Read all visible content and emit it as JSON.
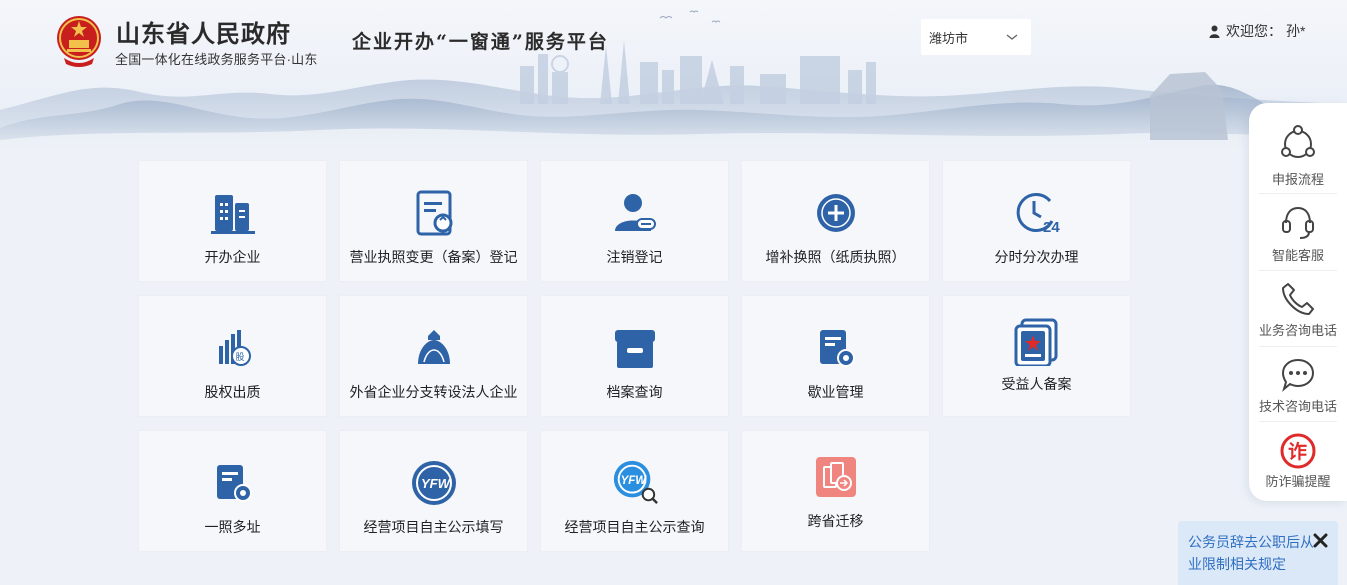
{
  "header": {
    "site_title": "山东省人民政府",
    "site_subtitle": "全国一体化在线政务服务平台·山东",
    "platform_title": "企业开办“一窗通”服务平台",
    "city_select": {
      "value": "潍坊市"
    },
    "user": {
      "greeting": "欢迎您：",
      "name": "孙*"
    }
  },
  "tiles": [
    {
      "label": "开办企业",
      "icon": "company-buildings-icon"
    },
    {
      "label": "营业执照变更（备案）登记",
      "icon": "document-change-icon"
    },
    {
      "label": "注销登记",
      "icon": "user-minus-icon"
    },
    {
      "label": "增补换照（纸质执照）",
      "icon": "plus-circle-icon"
    },
    {
      "label": "分时分次办理",
      "icon": "clock-24-icon"
    },
    {
      "label": "股权出质",
      "icon": "equity-pledge-icon"
    },
    {
      "label": "外省企业分支转设法人企业",
      "icon": "money-bag-icon"
    },
    {
      "label": "档案查询",
      "icon": "archive-box-icon"
    },
    {
      "label": "歇业管理",
      "icon": "document-gear-icon"
    },
    {
      "label": "受益人备案",
      "icon": "beneficiary-star-icon"
    },
    {
      "label": "一照多址",
      "icon": "license-gear-icon"
    },
    {
      "label": "经营项目自主公示填写",
      "icon": "yfw-badge-icon"
    },
    {
      "label": "经营项目自主公示查询",
      "icon": "yfw-search-icon"
    },
    {
      "label": "跨省迁移",
      "icon": "relocation-icon"
    }
  ],
  "float_bar": [
    {
      "label": "申报流程",
      "icon": "process-flow-icon"
    },
    {
      "label": "智能客服",
      "icon": "headset-icon"
    },
    {
      "label": "业务咨询电话",
      "icon": "phone-icon"
    },
    {
      "label": "技术咨询电话",
      "icon": "chat-bubble-icon"
    },
    {
      "label": "防诈骗提醒",
      "icon": "anti-fraud-icon",
      "char": "诈"
    }
  ],
  "notice": {
    "text": "公务员辞去公职后从业限制相关规定"
  },
  "colors": {
    "primary_blue": "#2f63a8",
    "accent_red": "#e02a2a",
    "relocation_pink": "#f0857f",
    "notice_text": "#2f6fc2"
  }
}
